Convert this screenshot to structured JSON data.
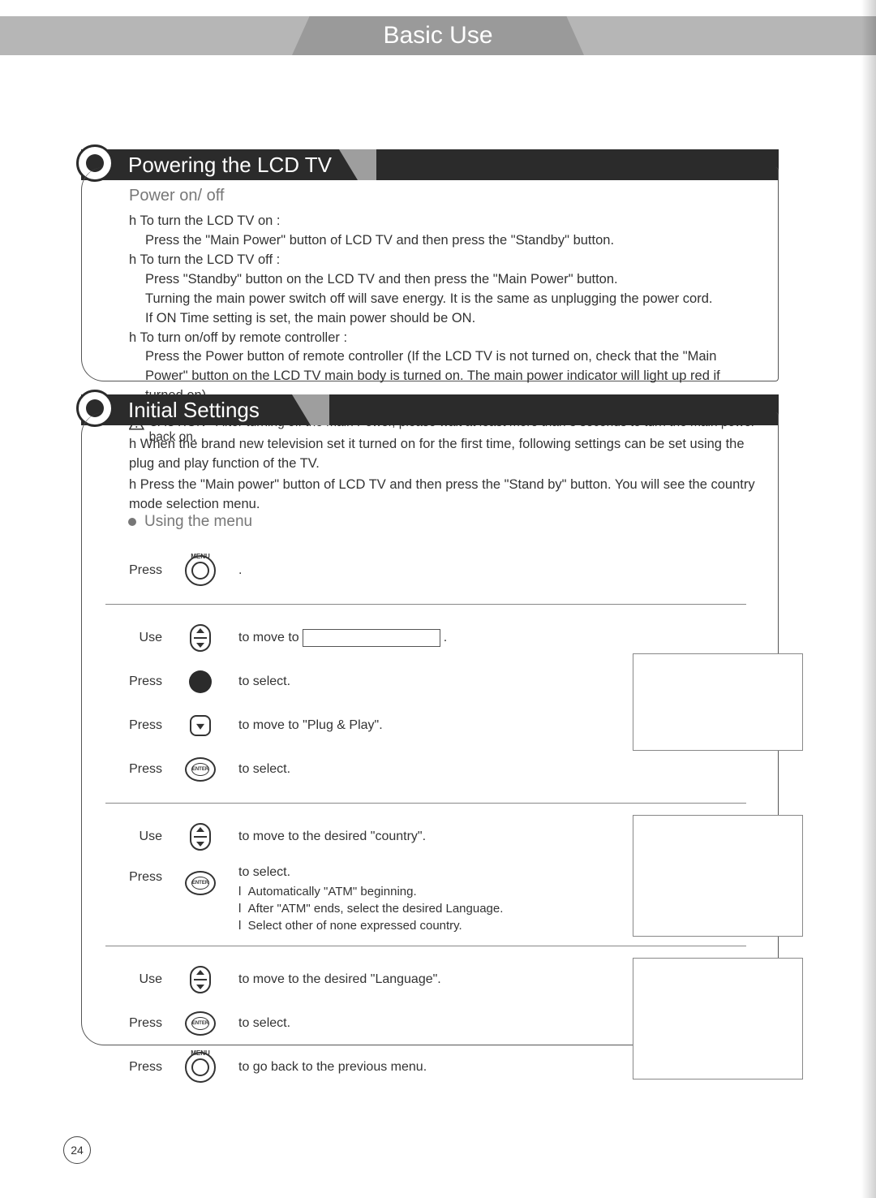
{
  "page": {
    "title": "Basic Use",
    "number": "24"
  },
  "section1": {
    "title": "Powering the LCD TV",
    "subhead": "Power on/ off",
    "items": [
      {
        "head": "To turn the LCD TV on :",
        "body": "Press the \"Main Power\" button of LCD TV and then press the \"Standby\" button."
      },
      {
        "head": "To turn the LCD TV off :",
        "body": "Press \"Standby\" button on the LCD TV and then press the \"Main Power\" button.\nTurning the main power switch off will save energy. It is the same as unplugging the power cord.\nIf ON Time setting is set, the main power should be ON."
      },
      {
        "head": "To turn on/off by remote controller :",
        "body": "Press the Power button of remote controller (If the LCD TV is not turned on, check that the \"Main Power\" button on the LCD TV main body is turned on. The main power indicator will light up red if turned on)."
      }
    ],
    "caution": "CAUTION - After turning off the main Power, please wait at least more than 3 seconds to turn the main power back on."
  },
  "section2": {
    "title": "Initial Settings",
    "intro": [
      "When the brand new television set it turned on for the first time, following settings can be set using the plug and play function of the TV.",
      "Press the \"Main power\" button of LCD TV and then press the \"Stand by\" button. You will see the country mode selection menu."
    ],
    "menu_head": "Using the menu",
    "labels": {
      "press": "Press",
      "use": "Use"
    },
    "buttons": {
      "menu": "MENU",
      "enter": "ENTER"
    },
    "group1": {
      "r1_desc": "."
    },
    "group2": {
      "r1_pre": "to move to",
      "r1_post": ".",
      "r2": "to select.",
      "r3": "to move to  \"Plug & Play\".",
      "r4": "to select."
    },
    "group3": {
      "r1": "to move to the desired \"country\".",
      "r2": "to select.",
      "notes": [
        "Automatically \"ATM\" beginning.",
        "After \"ATM\" ends, select the desired Language.",
        "Select other of none expressed country."
      ]
    },
    "group4": {
      "r1": "to move to the desired \"Language\".",
      "r2": "to select.",
      "r3": "to go back to the previous menu."
    }
  }
}
